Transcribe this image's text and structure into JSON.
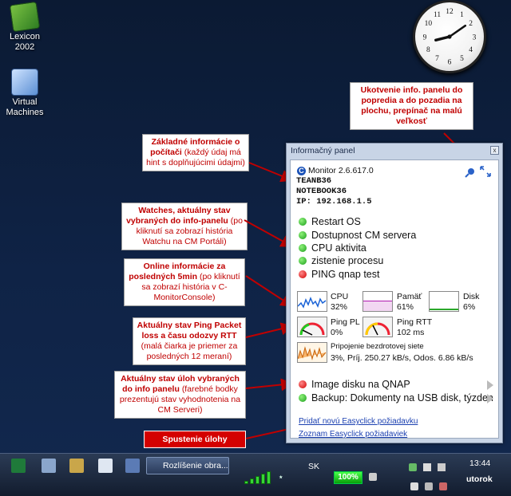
{
  "desktop": {
    "icons": [
      {
        "label": "Lexicon 2002"
      },
      {
        "label": "Virtual Machines"
      }
    ]
  },
  "callouts": {
    "pin": "Ukotvenie info. panelu do popredia a do pozadia na plochu, prepínač na malú veľkosť",
    "basic_title": "Základné informácie o počítači",
    "basic_sub": "(každý údaj má hint s doplňujúcimi údajmi)",
    "watches_title": "Watches, aktuálny stav vybraných do info-panelu",
    "watches_sub": "(po kliknutí sa zobrazí história Watchu na CM Portáli)",
    "online_title": "Online informácie za posledných 5min",
    "online_sub": "(po kliknutí sa zobrazí história v C-MonitorConsole)",
    "ping_title": "Aktuálny stav Ping Packet loss a času odozvy RTT",
    "ping_sub": "(malá čiarka je priemer za posledných 12 meraní)",
    "tasks_title": "Aktuálny stav úloh vybraných do info panelu",
    "tasks_sub": "(farebné bodky prezentujú stav vyhodnotenia na CM Serveri)",
    "start": "Spustenie úlohy"
  },
  "panel": {
    "title": "Informačný panel",
    "close": "x",
    "monitor": "Monitor 2.6.617.0",
    "team": "TEANB36",
    "host": "NOTEBOOK36",
    "ip": "IP: 192.168.1.5",
    "watches": [
      {
        "label": "Restart OS",
        "status": "green"
      },
      {
        "label": "Dostupnost CM servera",
        "status": "green"
      },
      {
        "label": "CPU aktivita",
        "status": "green"
      },
      {
        "label": "zistenie procesu",
        "status": "green"
      },
      {
        "label": "PING  qnap test",
        "status": "red"
      }
    ],
    "metrics": {
      "cpu_label": "CPU",
      "cpu_value": "32%",
      "mem_label": "Pamäť",
      "mem_value": "61%",
      "disk_label": "Disk",
      "disk_value": "6%",
      "pingpl_label": "Ping PL",
      "pingpl_value": "0%",
      "pingrtt_label": "Ping RTT",
      "pingrtt_value": "102 ms",
      "net_label": "Pripojenie bezdrotovej siete",
      "net_value": "3%, Príj. 250.27 kB/s, Odos. 6.86 kB/s"
    },
    "tasks": [
      {
        "label": "Image disku na QNAP",
        "status": "red"
      },
      {
        "label": "Backup: Dokumenty na USB disk, týzden",
        "status": "green"
      }
    ],
    "links": {
      "add": "Pridať novú Easyclick požiadavku",
      "list": "Zoznam Easyclick požiadaviek"
    }
  },
  "taskbar": {
    "task_label": "Rozlíšenie obra...",
    "lang": "SK",
    "battery": "100%",
    "time": "13:44",
    "day": "utorok"
  }
}
